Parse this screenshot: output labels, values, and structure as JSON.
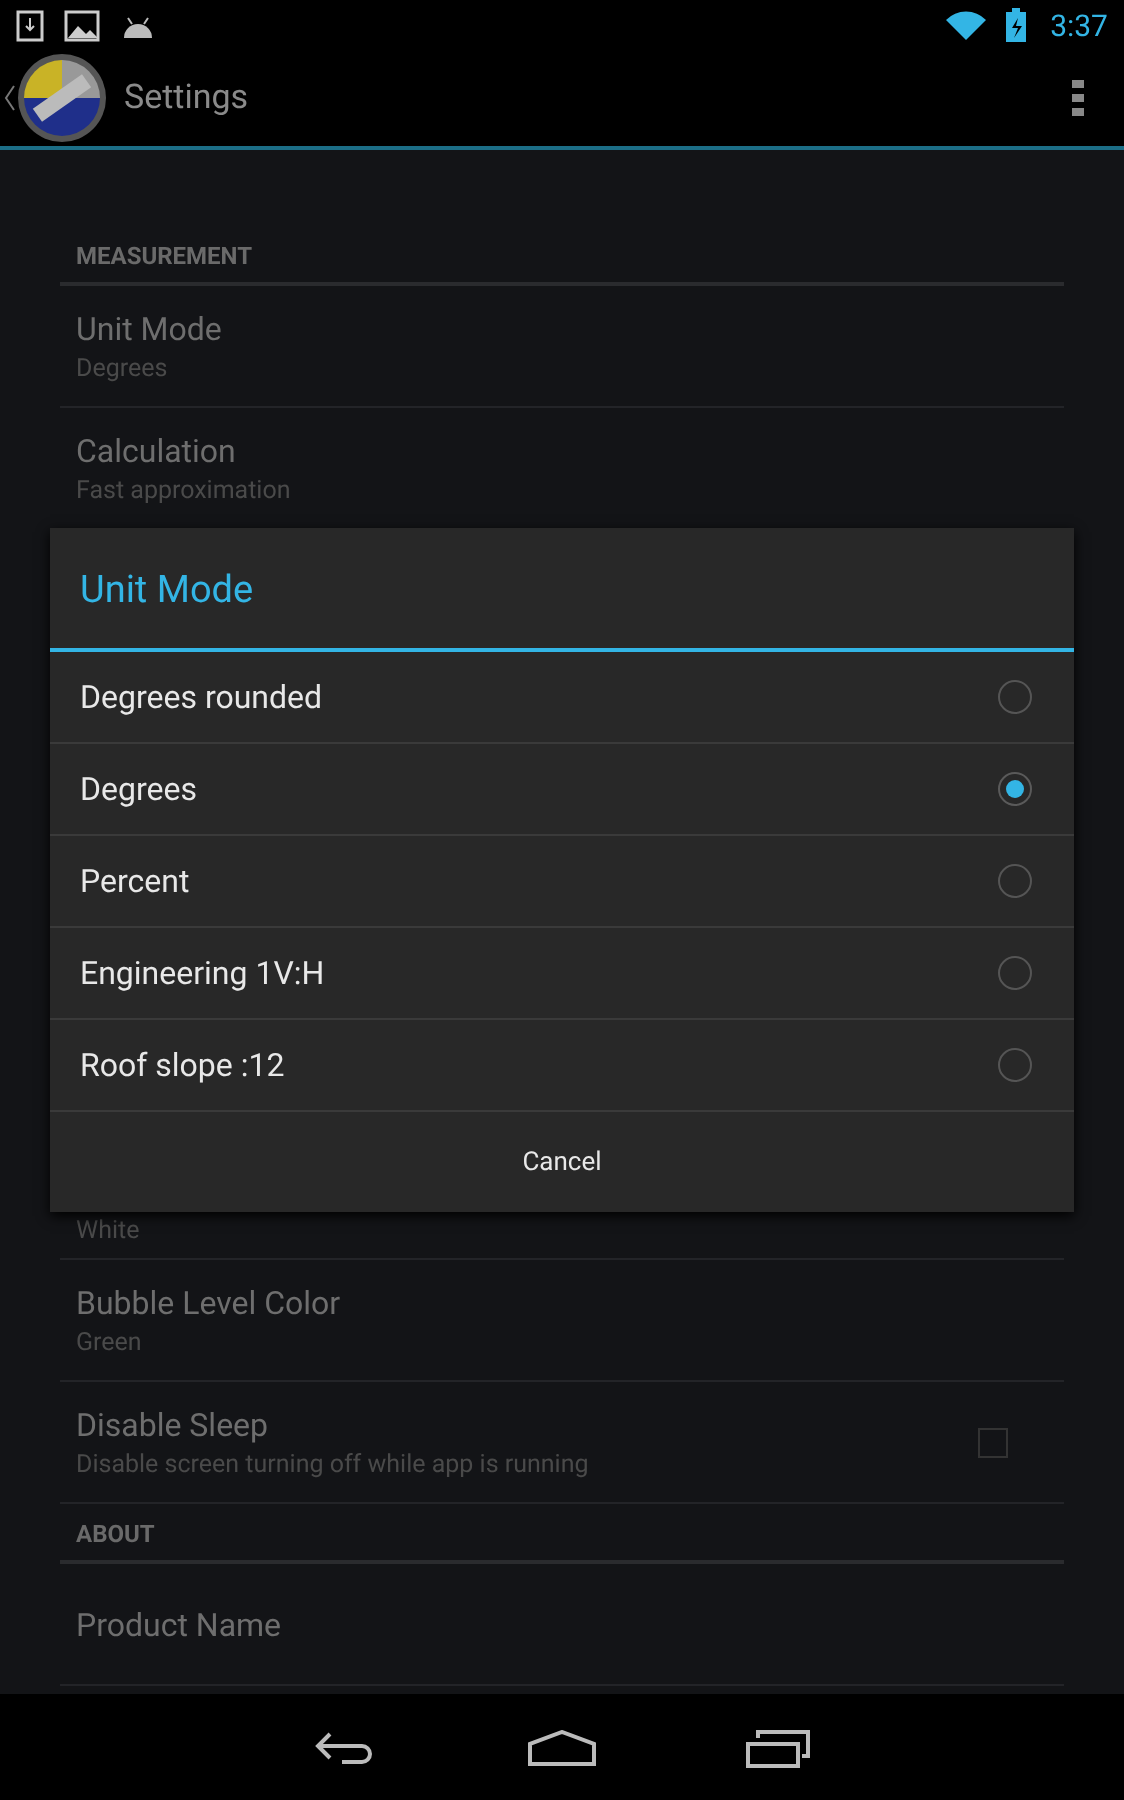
{
  "status_bar": {
    "time": "3:37"
  },
  "action_bar": {
    "title": "Settings"
  },
  "settings": [
    {
      "kind": "header",
      "title": "MEASUREMENT"
    },
    {
      "kind": "item",
      "title": "Unit Mode",
      "summary": "Degrees"
    },
    {
      "kind": "item",
      "title": "Calculation",
      "summary": "Fast approximation"
    },
    {
      "kind": "hidden",
      "summary": "White"
    },
    {
      "kind": "item",
      "title": "Bubble Level Color",
      "summary": "Green"
    },
    {
      "kind": "check",
      "title": "Disable Sleep",
      "summary": "Disable screen turning off while app is running",
      "checked": false
    },
    {
      "kind": "header",
      "title": "ABOUT"
    },
    {
      "kind": "item",
      "title": "Product Name"
    }
  ],
  "dialog": {
    "title": "Unit Mode",
    "options": [
      {
        "label": "Degrees rounded",
        "selected": false
      },
      {
        "label": "Degrees",
        "selected": true
      },
      {
        "label": "Percent",
        "selected": false
      },
      {
        "label": "Engineering 1V:H",
        "selected": false
      },
      {
        "label": "Roof slope :12",
        "selected": false
      }
    ],
    "cancel": "Cancel"
  }
}
